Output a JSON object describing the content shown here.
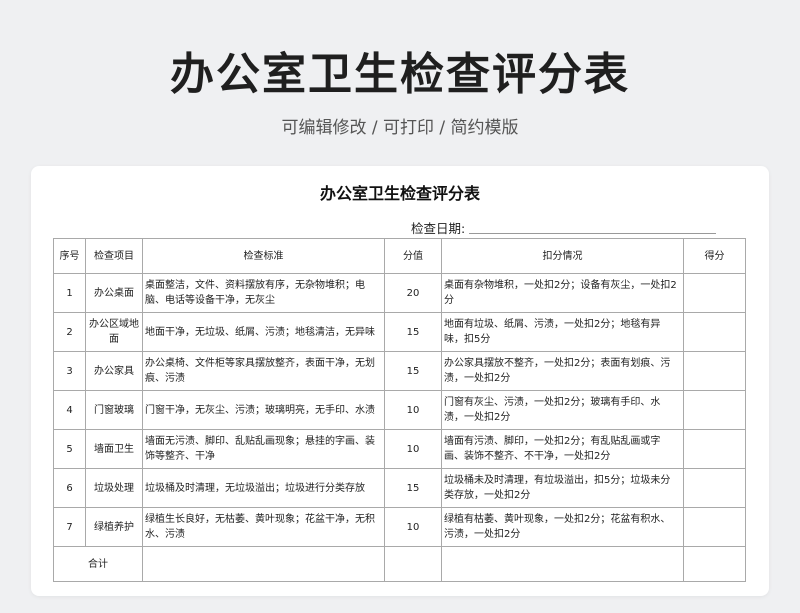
{
  "page": {
    "title": "办公室卫生检查评分表",
    "subtitle": "可编辑修改 /  可打印  /  简约模版"
  },
  "doc": {
    "title": "办公室卫生检查评分表",
    "date_label": "检查日期:",
    "headers": [
      "序号",
      "检查项目",
      "检查标准",
      "分值",
      "扣分情况",
      "得分"
    ],
    "rows": [
      {
        "no": "1",
        "item": "办公桌面",
        "standard": "桌面整洁，文件、资料摆放有序，无杂物堆积；电脑、电话等设备干净，无灰尘",
        "score": "20",
        "deduction": "桌面有杂物堆积，一处扣2分；设备有灰尘，一处扣2分",
        "got": ""
      },
      {
        "no": "2",
        "item": "办公区域地面",
        "standard": "地面干净，无垃圾、纸屑、污渍；地毯清洁，无异味",
        "score": "15",
        "deduction": "地面有垃圾、纸屑、污渍，一处扣2分；地毯有异味，扣5分",
        "got": ""
      },
      {
        "no": "3",
        "item": "办公家具",
        "standard": "办公桌椅、文件柜等家具摆放整齐，表面干净，无划痕、污渍",
        "score": "15",
        "deduction": "办公家具摆放不整齐，一处扣2分；表面有划痕、污渍，一处扣2分",
        "got": ""
      },
      {
        "no": "4",
        "item": "门窗玻璃",
        "standard": "门窗干净，无灰尘、污渍；玻璃明亮，无手印、水渍",
        "score": "10",
        "deduction": "门窗有灰尘、污渍，一处扣2分；玻璃有手印、水渍，一处扣2分",
        "got": ""
      },
      {
        "no": "5",
        "item": "墙面卫生",
        "standard": "墙面无污渍、脚印、乱贴乱画现象；悬挂的字画、装饰等整齐、干净",
        "score": "10",
        "deduction": "墙面有污渍、脚印，一处扣2分；有乱贴乱画或字画、装饰不整齐、不干净，一处扣2分",
        "got": ""
      },
      {
        "no": "6",
        "item": "垃圾处理",
        "standard": "垃圾桶及时清理，无垃圾溢出；垃圾进行分类存放",
        "score": "15",
        "deduction": "垃圾桶未及时清理，有垃圾溢出，扣5分；垃圾未分类存放，一处扣2分",
        "got": ""
      },
      {
        "no": "7",
        "item": "绿植养护",
        "standard": "绿植生长良好，无枯萎、黄叶现象；花盆干净，无积水、污渍",
        "score": "10",
        "deduction": "绿植有枯萎、黄叶现象，一处扣2分；花盆有积水、污渍，一处扣2分",
        "got": ""
      }
    ],
    "total_label": "合计"
  }
}
